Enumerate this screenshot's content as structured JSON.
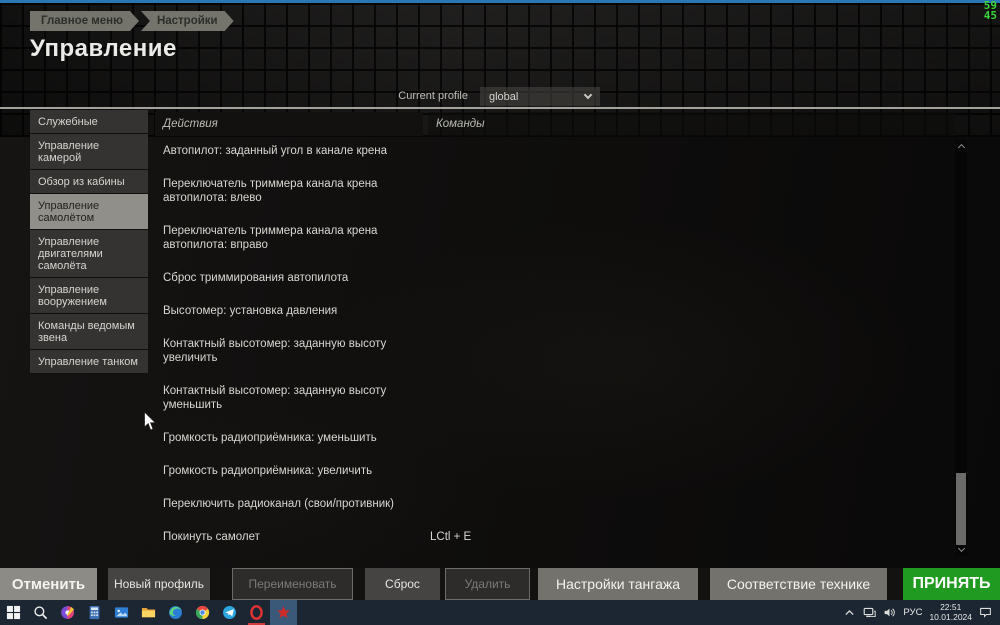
{
  "window": {
    "title": "Управление"
  },
  "fps_counter": {
    "line1": "59",
    "line2": "45"
  },
  "breadcrumb": {
    "items": [
      "Главное меню",
      "Настройки"
    ]
  },
  "profile_bar": {
    "label": "Current profile",
    "value": "global"
  },
  "sidebar": {
    "items": [
      {
        "label": "Служебные",
        "selected": false
      },
      {
        "label": "Управление камерой",
        "selected": false
      },
      {
        "label": "Обзор из кабины",
        "selected": false
      },
      {
        "label": "Управление самолётом",
        "selected": true
      },
      {
        "label": "Управление двигателями самолёта",
        "selected": false
      },
      {
        "label": "Управление вооружением",
        "selected": false
      },
      {
        "label": "Команды ведомым звена",
        "selected": false
      },
      {
        "label": "Управление танком",
        "selected": false
      }
    ]
  },
  "table": {
    "headers": {
      "actions": "Действия",
      "commands": "Команды"
    },
    "rows": [
      {
        "action": "Автопилот: заданный угол в канале крена",
        "command": ""
      },
      {
        "action": "Переключатель триммера канала крена автопилота: влево",
        "command": ""
      },
      {
        "action": "Переключатель триммера канала крена автопилота: вправо",
        "command": ""
      },
      {
        "action": "Сброс триммирования автопилота",
        "command": ""
      },
      {
        "action": "Высотомер: установка давления",
        "command": ""
      },
      {
        "action": "Контактный высотомер: заданную высоту увеличить",
        "command": ""
      },
      {
        "action": "Контактный высотомер: заданную высоту уменьшить",
        "command": ""
      },
      {
        "action": "Громкость радиоприёмника: уменьшить",
        "command": ""
      },
      {
        "action": "Громкость радиоприёмника: увеличить",
        "command": ""
      },
      {
        "action": "Переключить радиоканал (свои/противник)",
        "command": ""
      },
      {
        "action": "Покинуть самолет",
        "command": "LCtl + E"
      }
    ]
  },
  "footer": {
    "buttons": [
      {
        "id": "cancel",
        "label": "Отменить",
        "disabled": false
      },
      {
        "id": "new-profile",
        "label": "Новый профиль",
        "disabled": false
      },
      {
        "id": "rename",
        "label": "Переименовать",
        "disabled": true
      },
      {
        "id": "reset",
        "label": "Сброс",
        "disabled": false
      },
      {
        "id": "delete",
        "label": "Удалить",
        "disabled": true
      },
      {
        "id": "pitch-settings",
        "label": "Настройки тангажа",
        "disabled": false
      },
      {
        "id": "vehicle-match",
        "label": "Соответствие технике",
        "disabled": false
      },
      {
        "id": "accept",
        "label": "ПРИНЯТЬ",
        "disabled": false
      }
    ]
  },
  "taskbar": {
    "icons": [
      "windows-start-icon",
      "search-icon",
      "paint-icon",
      "calculator-icon",
      "photos-icon",
      "file-explorer-icon",
      "edge-icon",
      "chrome-icon",
      "telegram-icon",
      "opera-icon",
      "war-thunder-icon"
    ],
    "active_icon": "war-thunder-icon",
    "tray": {
      "language": "РУС",
      "time": "22:51",
      "date": "10.01.2024"
    }
  },
  "colors": {
    "accept_green": "#219a21",
    "fps_green": "#3bd43b",
    "top_line_blue": "#2b77b3",
    "taskbar_active": "#3a5878"
  }
}
